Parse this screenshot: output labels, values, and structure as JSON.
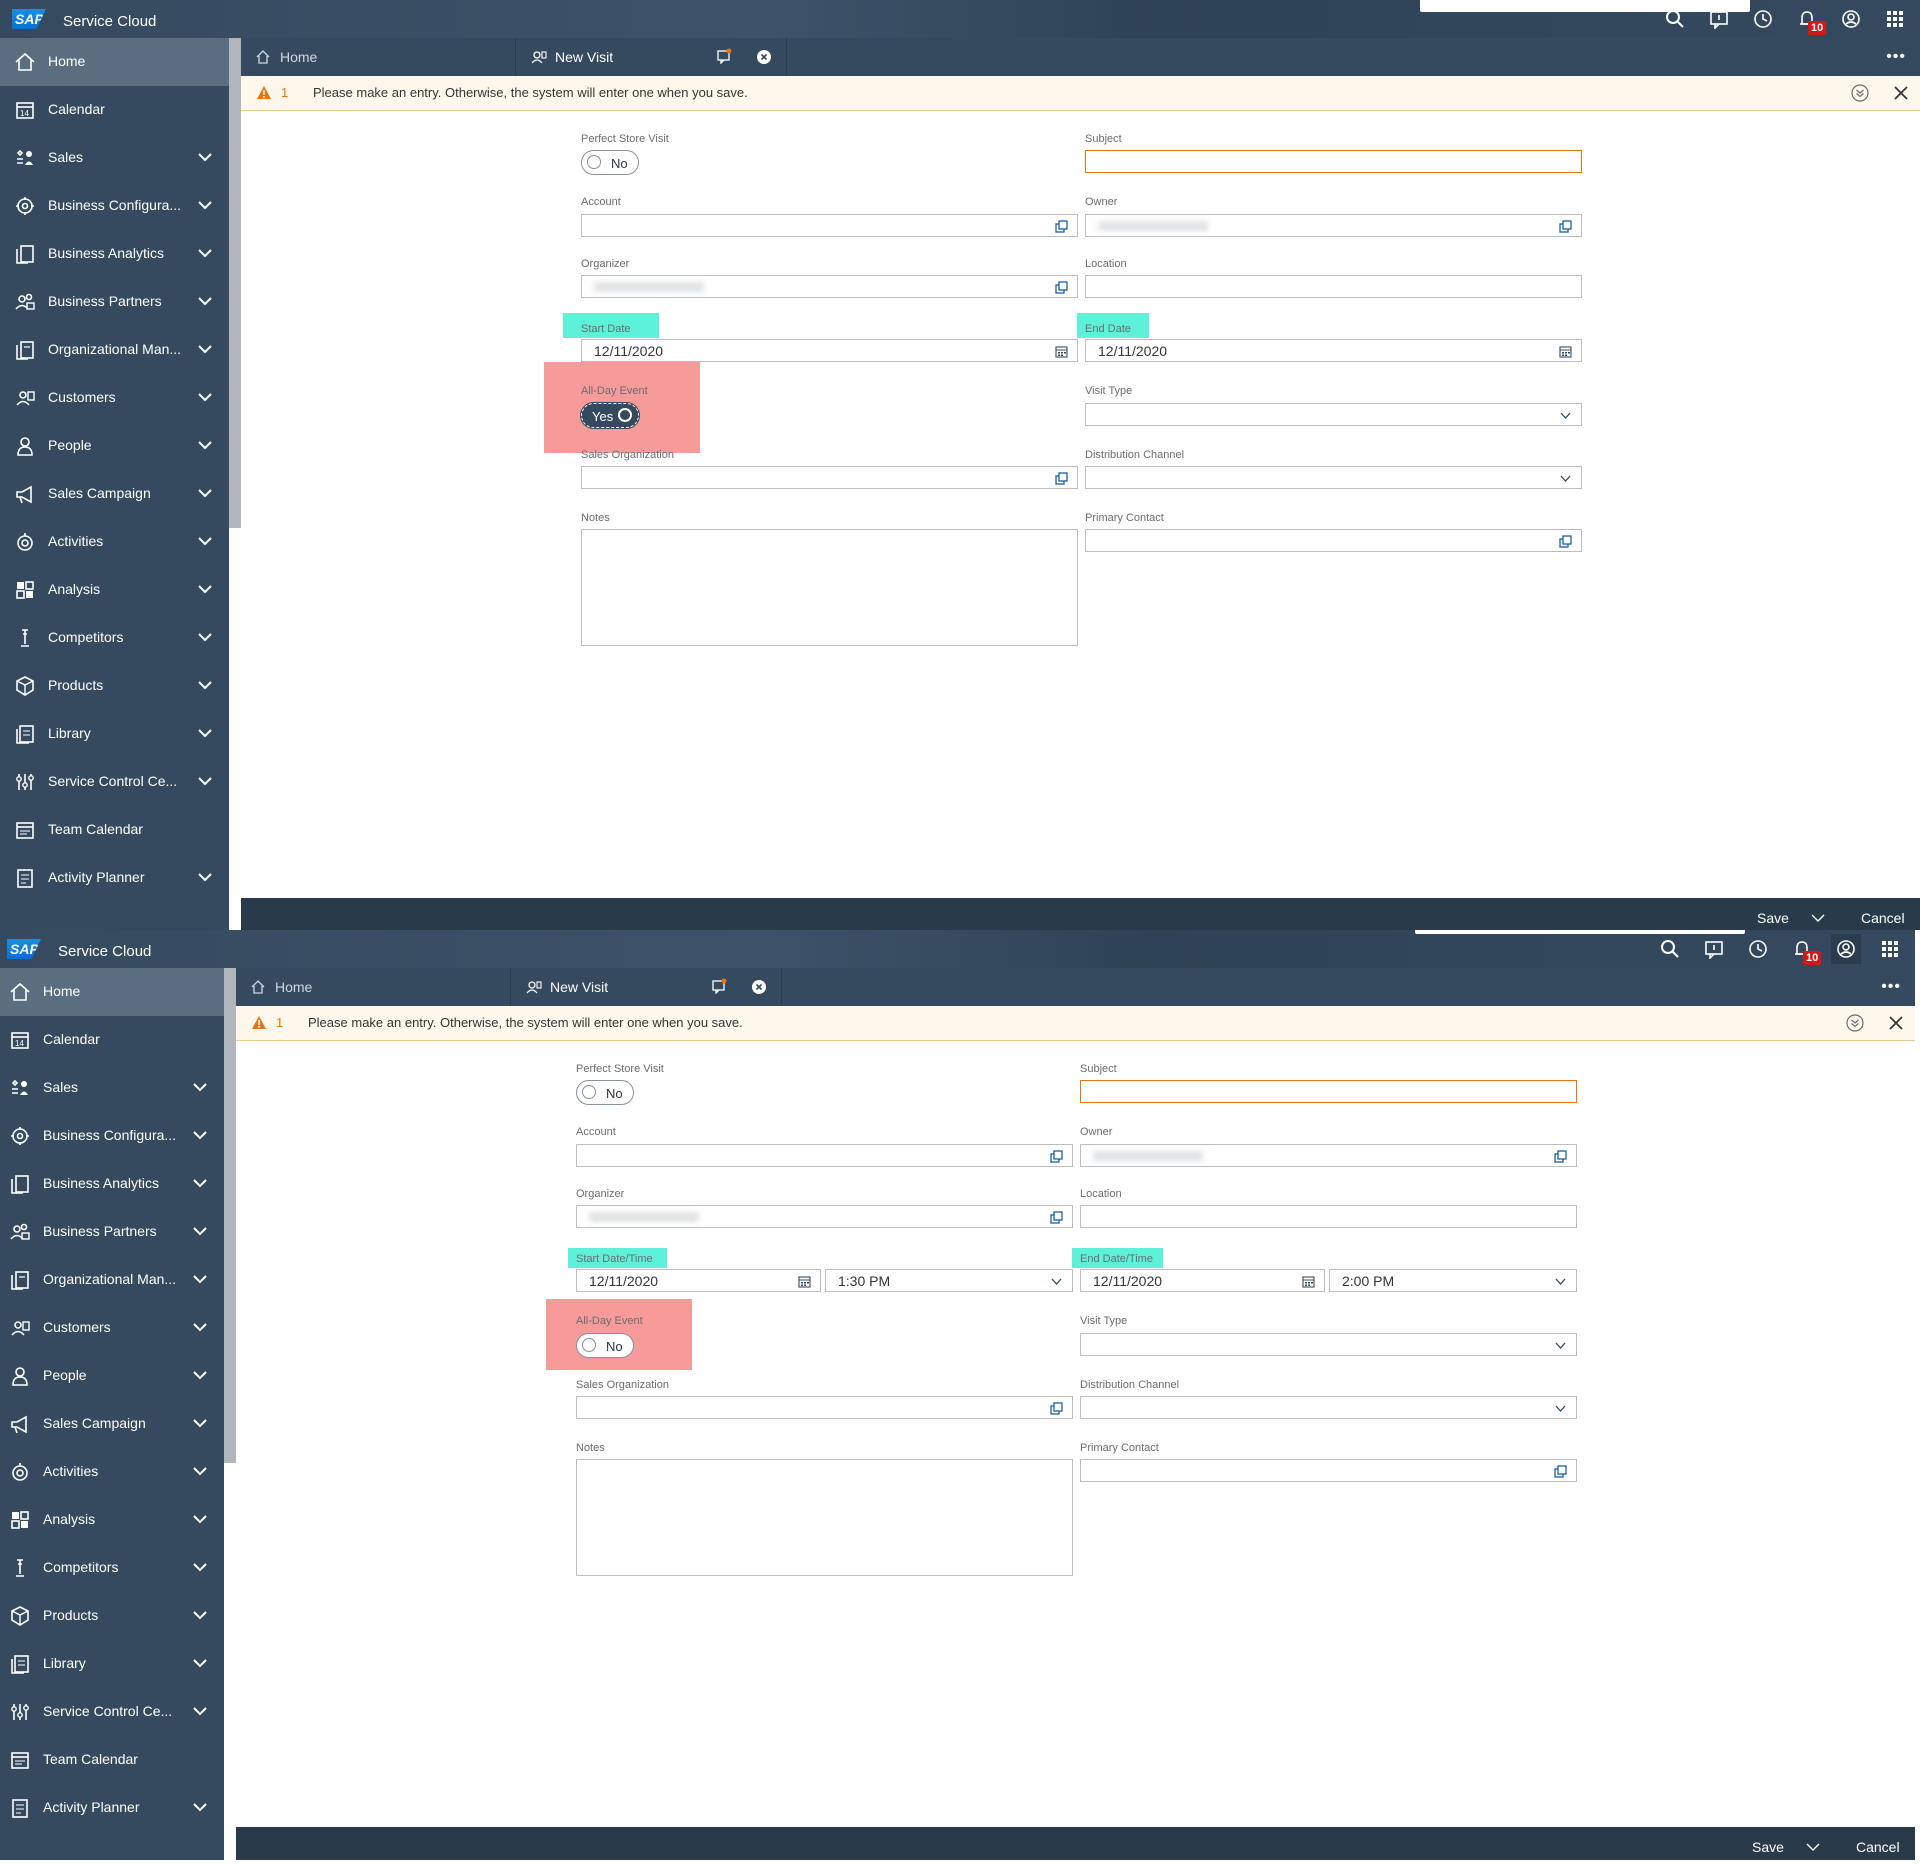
{
  "app": {
    "logo": "SAP",
    "title": "Service Cloud",
    "notification_count": "10"
  },
  "tabs": {
    "home": "Home",
    "new_visit": "New Visit"
  },
  "sidebar": {
    "items": [
      {
        "label": "Home",
        "icon": "home-icon",
        "expandable": false,
        "active": true
      },
      {
        "label": "Calendar",
        "icon": "calendar-icon",
        "expandable": false
      },
      {
        "label": "Sales",
        "icon": "sales-icon",
        "expandable": true
      },
      {
        "label": "Business Configura...",
        "icon": "business-config-icon",
        "expandable": true
      },
      {
        "label": "Business Analytics",
        "icon": "business-analytics-icon",
        "expandable": true
      },
      {
        "label": "Business Partners",
        "icon": "business-partners-icon",
        "expandable": true
      },
      {
        "label": "Organizational Man...",
        "icon": "org-management-icon",
        "expandable": true
      },
      {
        "label": "Customers",
        "icon": "customers-icon",
        "expandable": true
      },
      {
        "label": "People",
        "icon": "people-icon",
        "expandable": true
      },
      {
        "label": "Sales Campaign",
        "icon": "megaphone-icon",
        "expandable": true
      },
      {
        "label": "Activities",
        "icon": "activities-icon",
        "expandable": true
      },
      {
        "label": "Analysis",
        "icon": "analysis-icon",
        "expandable": true
      },
      {
        "label": "Competitors",
        "icon": "competitors-icon",
        "expandable": true
      },
      {
        "label": "Products",
        "icon": "products-icon",
        "expandable": true
      },
      {
        "label": "Library",
        "icon": "library-icon",
        "expandable": true
      },
      {
        "label": "Service Control Ce...",
        "icon": "service-control-icon",
        "expandable": true
      },
      {
        "label": "Team Calendar",
        "icon": "team-calendar-icon",
        "expandable": false
      },
      {
        "label": "Activity Planner",
        "icon": "activity-planner-icon",
        "expandable": true
      }
    ]
  },
  "message": {
    "count": "1",
    "text": "Please make an entry. Otherwise, the system will enter one when you save."
  },
  "form": {
    "perfect_store_visit_label": "Perfect Store Visit",
    "perfect_store_visit_value": "No",
    "subject_label": "Subject",
    "subject_value": "",
    "account_label": "Account",
    "owner_label": "Owner",
    "organizer_label": "Organizer",
    "location_label": "Location",
    "all_day_label": "All-Day Event",
    "visit_type_label": "Visit Type",
    "sales_org_label": "Sales Organization",
    "distribution_channel_label": "Distribution Channel",
    "notes_label": "Notes",
    "primary_contact_label": "Primary Contact"
  },
  "panel1": {
    "start_label": "Start Date",
    "end_label": "End Date",
    "start_date": "12/11/2020",
    "end_date": "12/11/2020",
    "all_day_value": "Yes"
  },
  "panel2": {
    "start_label": "Start Date/Time",
    "end_label": "End Date/Time",
    "start_date": "12/11/2020",
    "start_time": "1:30 PM",
    "end_date": "12/11/2020",
    "end_time": "2:00 PM",
    "all_day_value": "No"
  },
  "footer": {
    "save": "Save",
    "cancel": "Cancel"
  },
  "colors": {
    "shell": "#354a5f",
    "warning": "#e9730c",
    "highlight_cyan": "#5cf1d8",
    "highlight_red": "#f79a9a",
    "badge": "#d51717"
  }
}
